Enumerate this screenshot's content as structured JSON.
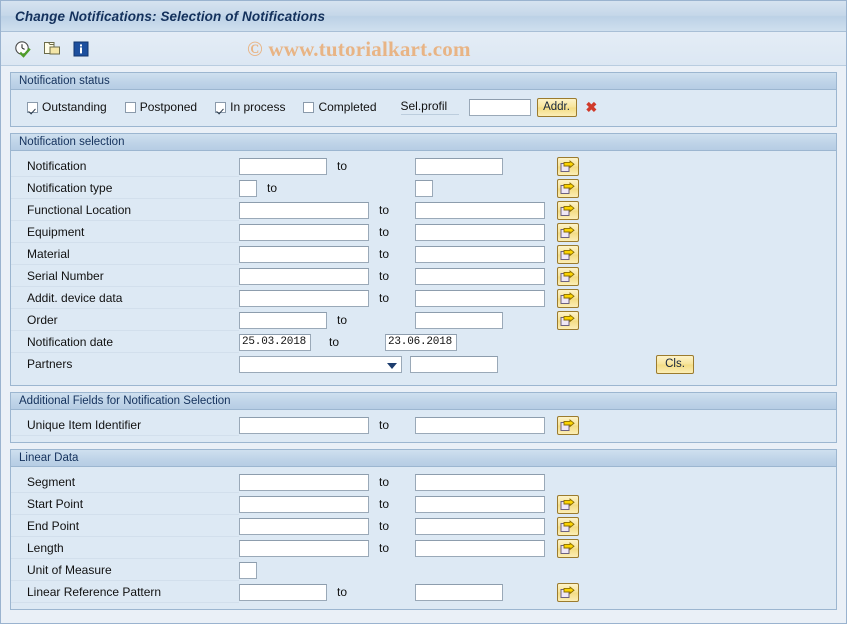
{
  "window": {
    "title": "Change Notifications: Selection of Notifications",
    "watermark": "© www.tutorialkart.com"
  },
  "toolbar": {
    "items": [
      {
        "name": "execute-clock-icon",
        "tooltip": "Execute"
      },
      {
        "name": "multiple-selection-icon",
        "tooltip": "Multiple Selection"
      },
      {
        "name": "info-icon",
        "tooltip": "Information"
      }
    ]
  },
  "colors": {
    "title_text": "#14315c",
    "panel_border": "#9cb6d0",
    "panel_bg": "#dde9f4",
    "button_yellow": "#f3dc84",
    "watermark": "#e8b485",
    "delete_red": "#d03a2a"
  },
  "status_panel": {
    "title": "Notification status",
    "checkboxes": [
      {
        "label": "Outstanding",
        "checked": true
      },
      {
        "label": "Postponed",
        "checked": false
      },
      {
        "label": "In process",
        "checked": true
      },
      {
        "label": "Completed",
        "checked": false
      }
    ],
    "sel_profil": {
      "label": "Sel.profil",
      "value": "",
      "button_label": "Addr.",
      "delete_icon": "✖"
    }
  },
  "selection_panel": {
    "title": "Notification selection",
    "to_label": "to",
    "rows": [
      {
        "label": "Notification",
        "from": "",
        "to": "",
        "width": "narrow",
        "arrow": true
      },
      {
        "label": "Notification type",
        "from": "",
        "to": "",
        "width": "tiny",
        "arrow": true
      },
      {
        "label": "Functional Location",
        "from": "",
        "to": "",
        "width": "wide",
        "arrow": true
      },
      {
        "label": "Equipment",
        "from": "",
        "to": "",
        "width": "wide",
        "arrow": true
      },
      {
        "label": "Material",
        "from": "",
        "to": "",
        "width": "wide",
        "arrow": true
      },
      {
        "label": "Serial Number",
        "from": "",
        "to": "",
        "width": "wide",
        "arrow": true
      },
      {
        "label": "Addit. device data",
        "from": "",
        "to": "",
        "width": "wide",
        "arrow": true
      },
      {
        "label": "Order",
        "from": "",
        "to": "",
        "width": "narrow",
        "arrow": true
      },
      {
        "label": "Notification date",
        "from": "25.03.2018",
        "to": "23.06.2018",
        "width": "narrow",
        "arrow": false,
        "mono": true
      }
    ],
    "partners": {
      "label": "Partners",
      "dropdown_value": "",
      "value": "",
      "button_label": "Cls."
    }
  },
  "additional_panel": {
    "title": "Additional Fields for Notification Selection",
    "to_label": "to",
    "rows": [
      {
        "label": "Unique Item Identifier",
        "from": "",
        "to": "",
        "width": "wide",
        "arrow": true
      }
    ]
  },
  "linear_panel": {
    "title": "Linear Data",
    "to_label": "to",
    "rows": [
      {
        "label": "Segment",
        "from": "",
        "to": "",
        "width": "wide",
        "arrow": false
      },
      {
        "label": "Start Point",
        "from": "",
        "to": "",
        "width": "wide",
        "arrow": true
      },
      {
        "label": "End Point",
        "from": "",
        "to": "",
        "width": "wide",
        "arrow": true
      },
      {
        "label": "Length",
        "from": "",
        "to": "",
        "width": "wide",
        "arrow": true
      },
      {
        "label": "Unit of Measure",
        "from": "",
        "to": null,
        "width": "tiny",
        "arrow": false
      },
      {
        "label": "Linear Reference Pattern",
        "from": "",
        "to": "",
        "width": "narrow",
        "arrow": true
      }
    ]
  }
}
